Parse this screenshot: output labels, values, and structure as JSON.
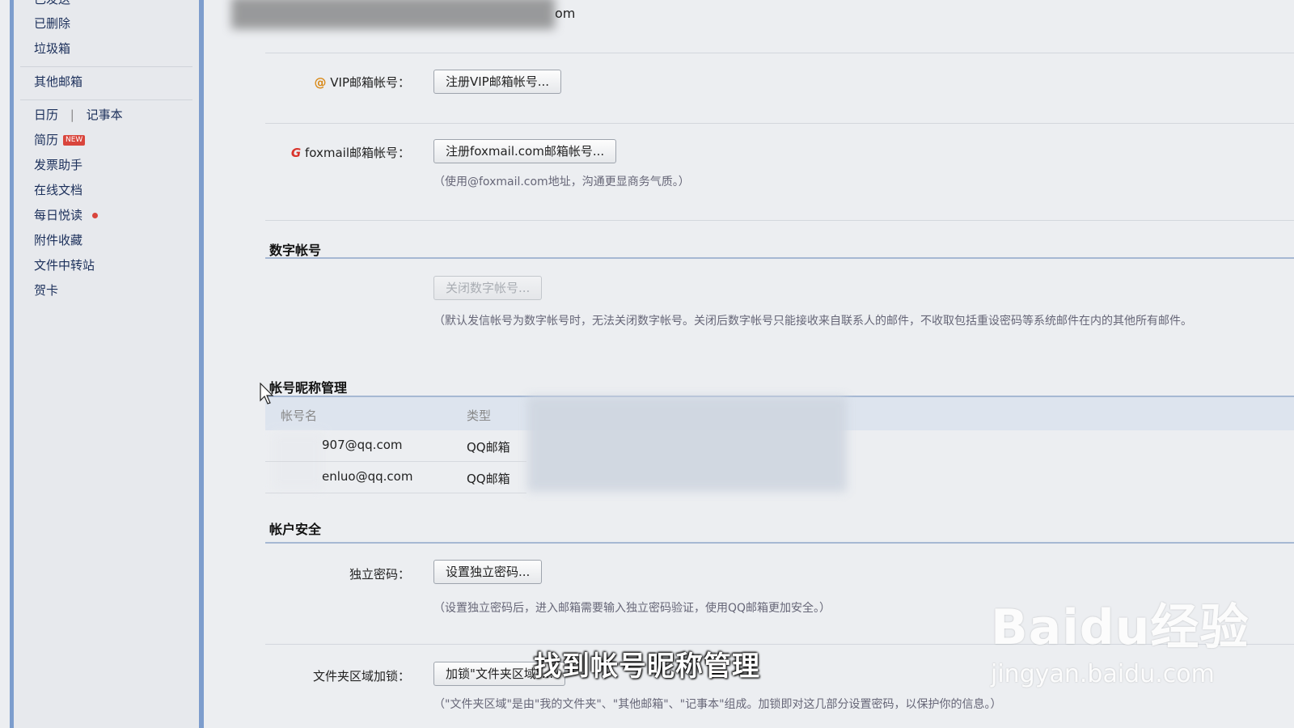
{
  "sidebar": {
    "items": [
      {
        "label": "已发送"
      },
      {
        "label": "已删除"
      },
      {
        "label": "垃圾箱"
      },
      {
        "label": "其他邮箱"
      },
      {
        "label": "日历"
      },
      {
        "label": "记事本"
      },
      {
        "label": "简历",
        "badge": "NEW"
      },
      {
        "label": "发票助手"
      },
      {
        "label": "在线文档"
      },
      {
        "label": "每日悦读"
      },
      {
        "label": "附件收藏"
      },
      {
        "label": "文件中转站"
      },
      {
        "label": "贺卡"
      }
    ],
    "calendar_separator": "|"
  },
  "top": {
    "partial_email": "om"
  },
  "vip": {
    "label": "VIP邮箱帐号：",
    "button": "注册VIP邮箱帐号..."
  },
  "foxmail": {
    "label": "foxmail邮箱帐号：",
    "button": "注册foxmail.com邮箱帐号...",
    "hint": "（使用@foxmail.com地址，沟通更显商务气质。）"
  },
  "digital": {
    "title": "数字帐号",
    "button": "关闭数字帐号...",
    "hint": "（默认发信帐号为数字帐号时，无法关闭数字帐号。关闭后数字帐号只能接收来自联系人的邮件，不收取包括重设密码等系统邮件在内的其他所有邮件。"
  },
  "nickname": {
    "title": "帐号昵称管理",
    "columns": [
      "帐号名",
      "类型"
    ],
    "rows": [
      {
        "account": "907@qq.com",
        "type": "QQ邮箱"
      },
      {
        "account": "enluo@qq.com",
        "type": "QQ邮箱"
      }
    ]
  },
  "security": {
    "title": "帐户安全",
    "password_label": "独立密码：",
    "password_button": "设置独立密码...",
    "password_hint": "（设置独立密码后，进入邮箱需要输入独立密码验证，使用QQ邮箱更加安全。）",
    "folder_label": "文件夹区域加锁：",
    "folder_button": "加锁\"文件夹区域\"...",
    "folder_hint": "（\"文件夹区域\"是由\"我的文件夹\"、\"其他邮箱\"、\"记事本\"组成。加锁即对这几部分设置密码，以保护你的信息。）"
  },
  "overlay": {
    "subtitle": "找到帐号昵称管理",
    "watermark_logo": "Baidu经验",
    "watermark_url": "jingyan.baidu.com"
  },
  "colors": {
    "sidebar_accent": "#7d9dcd",
    "link_text": "#1b2f5a",
    "badge_red": "#d9453c",
    "foxmail_red": "#d9332b",
    "vip_orange": "#d98a1a"
  }
}
